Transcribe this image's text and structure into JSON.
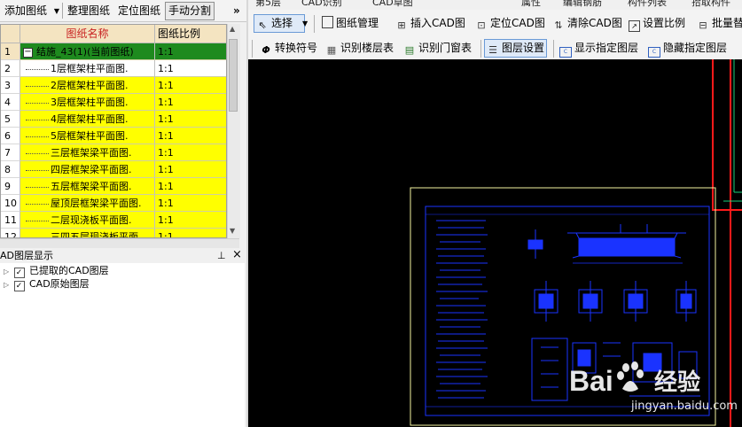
{
  "left_toolbar": {
    "add_drawing": "添加图纸",
    "organize_drawing": "整理图纸",
    "locate_drawing": "定位图纸",
    "manual_split": "手动分割",
    "more": "»"
  },
  "grid": {
    "columns": [
      "图纸名称",
      "图纸比例"
    ],
    "rows": [
      {
        "num": "1",
        "name": "结施_43(1)(当前图纸)",
        "scale": "1:1",
        "style": "green"
      },
      {
        "num": "2",
        "name": "1层框架柱平面图.",
        "scale": "1:1",
        "style": "white"
      },
      {
        "num": "3",
        "name": "2层框架柱平面图.",
        "scale": "1:1",
        "style": "yellow"
      },
      {
        "num": "4",
        "name": "3层框架柱平面图.",
        "scale": "1:1",
        "style": "yellow"
      },
      {
        "num": "5",
        "name": "4层框架柱平面图.",
        "scale": "1:1",
        "style": "yellow"
      },
      {
        "num": "6",
        "name": "5层框架柱平面图.",
        "scale": "1:1",
        "style": "yellow"
      },
      {
        "num": "7",
        "name": "三层框架梁平面图.",
        "scale": "1:1",
        "style": "yellow"
      },
      {
        "num": "8",
        "name": "四层框架梁平面图.",
        "scale": "1:1",
        "style": "yellow"
      },
      {
        "num": "9",
        "name": "五层框架梁平面图.",
        "scale": "1:1",
        "style": "yellow"
      },
      {
        "num": "10",
        "name": "屋顶层框架梁平面图.",
        "scale": "1:1",
        "style": "yellow"
      },
      {
        "num": "11",
        "name": "二层现浇板平面图.",
        "scale": "1:1",
        "style": "yellow"
      },
      {
        "num": "12",
        "name": "三四五层现浇板平面",
        "scale": "1:1",
        "style": "yellow"
      }
    ]
  },
  "layer_panel": {
    "title": "AD图层显示",
    "pin": "⊥",
    "close": "×",
    "items": [
      {
        "label": "已提取的CAD图层",
        "checked": "✓"
      },
      {
        "label": "CAD原始图层",
        "checked": "✓"
      }
    ]
  },
  "tabstrip": {
    "items": [
      "第5层",
      "CAD识别",
      "CAD草图",
      "属性",
      "编辑钢筋",
      "构件列表",
      "拾取构件"
    ]
  },
  "toolbar1": {
    "select": "选择",
    "drawing_manage": "图纸管理",
    "insert_cad": "插入CAD图",
    "locate_cad": "定位CAD图",
    "clear_cad": "清除CAD图",
    "set_scale": "设置比例",
    "batch_replace": "批量替"
  },
  "toolbar2": {
    "convert_symbol": "转换符号",
    "identify_floor_table": "识别楼层表",
    "identify_door_window_table": "识别门窗表",
    "layer_settings": "图层设置",
    "show_layer": "显示指定图层",
    "hide_layer": "隐藏指定图层"
  },
  "colors": {
    "canvas": "#000000",
    "cad_blue": "#1a33ff",
    "frame_yellow": "#f5f5a0",
    "red_line": "#ff1a1a",
    "green_line": "#19d07a",
    "row_yellow": "#ffff00",
    "row_green": "#1e8a1e",
    "header_bg": "#f4e4c1"
  },
  "watermark": {
    "brand": "Bai",
    "brand2": "经验",
    "url": "jingyan.baidu.com"
  }
}
